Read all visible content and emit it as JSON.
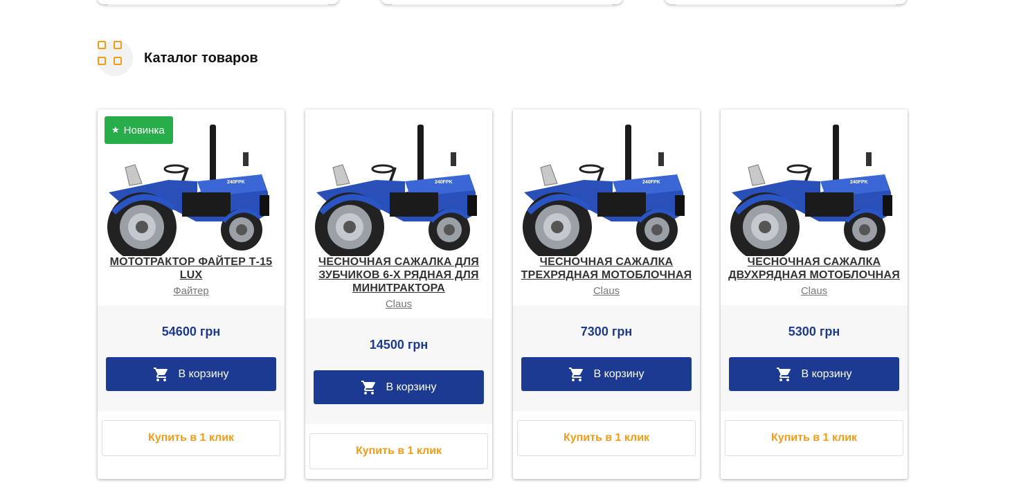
{
  "catalog": {
    "title": "Каталог товаров"
  },
  "products": [
    {
      "badge": "Новинка",
      "title": "МОТОТРАКТОР ФАЙТЕР Т-15 LUX",
      "brand": "Файтер",
      "price": "54600 грн",
      "cart_label": "В корзину",
      "one_click_label": "Купить в 1 клик"
    },
    {
      "badge": "",
      "title": "ЧЕСНОЧНАЯ САЖАЛКА ДЛЯ ЗУБЧИКОВ 6-Х РЯДНАЯ ДЛЯ МИНИТРАКТОРА",
      "brand": "Claus",
      "price": "14500 грн",
      "cart_label": "В корзину",
      "one_click_label": "Купить в 1 клик"
    },
    {
      "badge": "",
      "title": "ЧЕСНОЧНАЯ САЖАЛКА ТРЕХРЯДНАЯ МОТОБЛОЧНАЯ",
      "brand": "Claus",
      "price": "7300 грн",
      "cart_label": "В корзину",
      "one_click_label": "Купить в 1 клик"
    },
    {
      "badge": "",
      "title": "ЧЕСНОЧНАЯ САЖАЛКА ДВУХРЯДНАЯ МОТОБЛОЧНАЯ",
      "brand": "Claus",
      "price": "5300 грн",
      "cart_label": "В корзину",
      "one_click_label": "Купить в 1 клик"
    }
  ],
  "icons": {
    "catalog": "grid-icon",
    "cart": "cart-icon",
    "badge": "star-icon"
  },
  "colors": {
    "accent": "#f49c18",
    "primary": "#1c3a92",
    "price": "#1c3a8e",
    "badge": "#27ae4a"
  }
}
